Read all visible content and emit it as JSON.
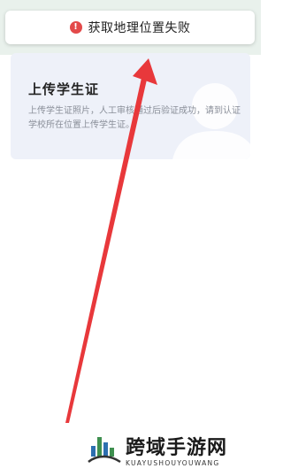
{
  "toast": {
    "icon": "alert-circle-icon",
    "text": "获取地理位置失败"
  },
  "card": {
    "title": "上传学生证",
    "description": "上传学生证照片，人工审核通过后验证成功，请到认证学校所在位置上传学生证。"
  },
  "watermark": {
    "title": "跨域手游网",
    "subtitle": "KUAYUSHOUYOUWANG"
  },
  "colors": {
    "toast_icon": "#e34a4a",
    "arrow": "#e8383b",
    "card_bg": "#eef1f9",
    "topbar_bg": "#e9f1ec"
  }
}
